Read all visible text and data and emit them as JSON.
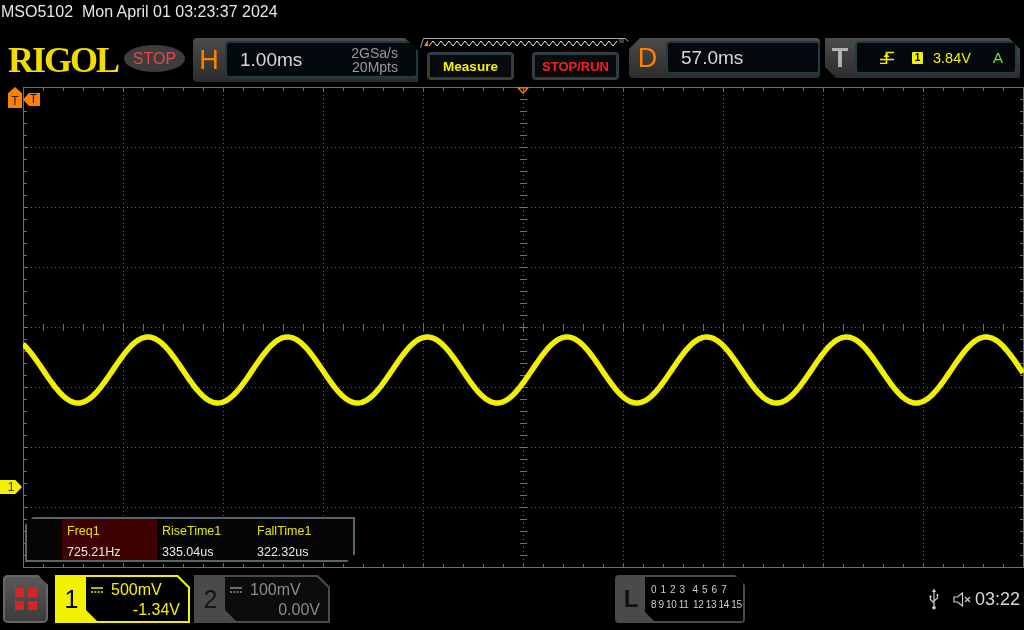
{
  "title_bar": {
    "text": "MSO5102  Mon April 01 03:23:37 2024"
  },
  "toolbar": {
    "logo": "RIGOL",
    "run_state": "STOP",
    "horizontal": {
      "letter": "H",
      "timebase": "1.00ms",
      "sample_rate": "2GSa/s",
      "memory_depth": "20Mpts"
    },
    "buttons": [
      {
        "label": "Measure",
        "kind": "measure"
      },
      {
        "label": "STOP/RUN",
        "kind": "run_stop"
      }
    ],
    "delay": {
      "letter": "D",
      "value": "57.0ms"
    },
    "trigger": {
      "letter": "T",
      "source": "1",
      "level": "3.84V",
      "mode": "A"
    }
  },
  "display": {
    "trigger_position_marker": {
      "label": "T"
    },
    "trigger_level_marker": {
      "label": "T"
    },
    "channel_markers": [
      {
        "label": "1"
      }
    ],
    "measurements": [
      {
        "label": "Freq1",
        "value": "725.21Hz",
        "selected": true
      },
      {
        "label": "RiseTime1",
        "value": "335.04us",
        "selected": false
      },
      {
        "label": "FallTime1",
        "value": "322.32us",
        "selected": false
      }
    ]
  },
  "channels": [
    {
      "number": "1",
      "scale": "500mV",
      "offset": "-1.34V",
      "active": true
    },
    {
      "number": "2",
      "scale": "100mV",
      "offset": "0.00V",
      "active": false
    }
  ],
  "logic": {
    "letter": "L",
    "rows": [
      "0 1 2 3  4 5 6 7",
      "8 9 10 11  12 13 14 15"
    ]
  },
  "status_bar": {
    "time": "03:22"
  }
}
